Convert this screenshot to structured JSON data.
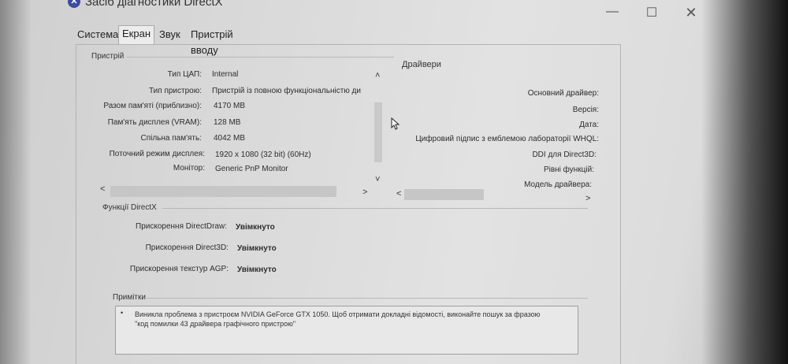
{
  "window": {
    "title": "Засіб діагностики DirectX",
    "icon": "directx-icon",
    "controls": {
      "minimize": "—",
      "maximize": "☐",
      "close": "✕"
    }
  },
  "tabs": [
    {
      "label": "Система",
      "active": false
    },
    {
      "label": "Екран",
      "active": true
    },
    {
      "label": "Звук",
      "active": false
    },
    {
      "label": "Пристрій вводу",
      "active": false
    }
  ],
  "device": {
    "section_title": "Пристрій",
    "rows": [
      {
        "label": "Тип ЦАП:",
        "value": "Internal"
      },
      {
        "label": "Тип пристрою:",
        "value": "Пристрій із повною функціональністю ди"
      },
      {
        "label": "Разом пам'яті (приблизно):",
        "value": "4170 MB"
      },
      {
        "label": "Пам'ять дисплея (VRAM):",
        "value": "128 MB"
      },
      {
        "label": "Спільна пам'ять:",
        "value": "4042 MB"
      },
      {
        "label": "Поточний режим дисплея:",
        "value": "1920 x 1080 (32 bit) (60Hz)"
      },
      {
        "label": "Монітор:",
        "value": "Generic PnP Monitor"
      }
    ]
  },
  "drivers": {
    "section_title": "Драйвери",
    "rows": [
      {
        "label": "Основний драйвер:",
        "value": ""
      },
      {
        "label": "Версія:",
        "value": ""
      },
      {
        "label": "Дата:",
        "value": ""
      },
      {
        "label": "Цифровий підпис з емблемою лабораторії WHQL:",
        "value": ""
      },
      {
        "label": "DDI для Direct3D:",
        "value": ""
      },
      {
        "label": "Рівні функцій:",
        "value": ""
      },
      {
        "label": "Модель драйвера:",
        "value": ""
      }
    ]
  },
  "directx_features": {
    "section_title": "Функції DirectX",
    "rows": [
      {
        "label": "Прискорення DirectDraw:",
        "value": "Увімкнуто"
      },
      {
        "label": "Прискорення Direct3D:",
        "value": "Увімкнуто"
      },
      {
        "label": "Прискорення текстур AGP:",
        "value": "Увімкнуто"
      }
    ]
  },
  "notes": {
    "section_title": "Примітки",
    "bullet": "•",
    "lines": [
      "Виникла проблема з пристроєм NVIDIA GeForce GTX 1050. Щоб отримати докладні відомості, виконайте пошук за фразою",
      "\"код помилки 43 драйвера графічного пристрою\""
    ]
  },
  "scroll": {
    "up": "˄",
    "down": "˅",
    "left": "<",
    "right": ">"
  }
}
